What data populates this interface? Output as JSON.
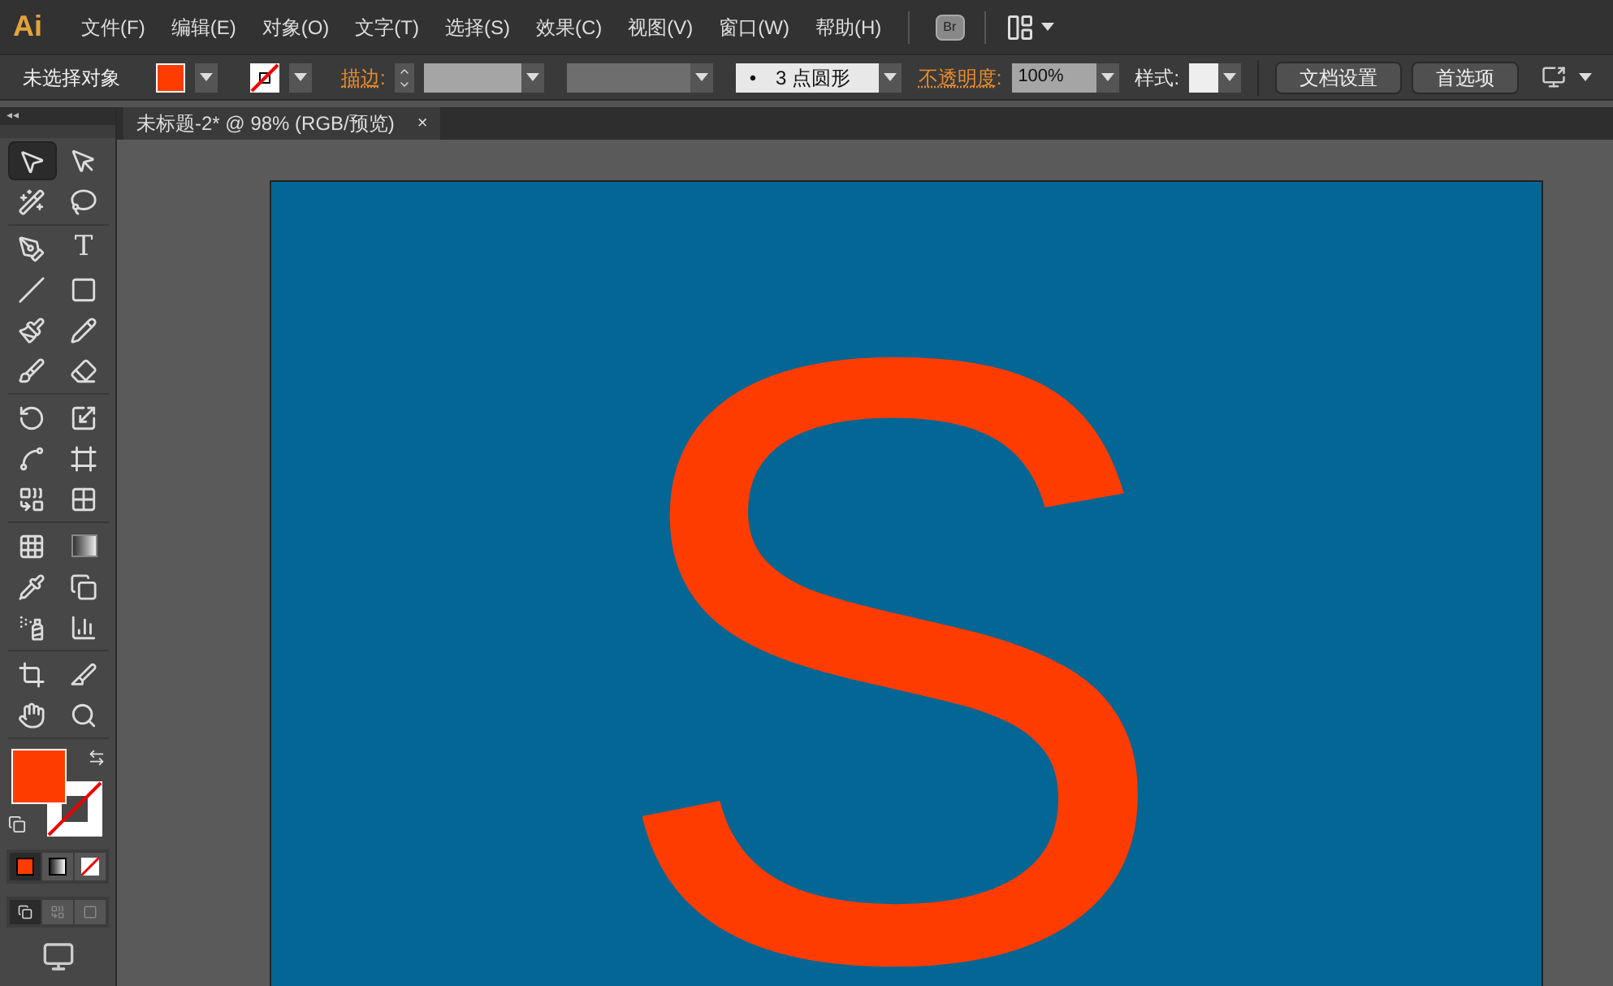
{
  "app": {
    "logo": "Ai"
  },
  "menu": [
    "文件(F)",
    "编辑(E)",
    "对象(O)",
    "文字(T)",
    "选择(S)",
    "效果(C)",
    "视图(V)",
    "窗口(W)",
    "帮助(H)"
  ],
  "bridge_button": {
    "label": "Br"
  },
  "control_bar": {
    "selection": "未选择对象",
    "fill": {
      "color": "#ff3c00"
    },
    "stroke": {
      "none": true
    },
    "stroke_label": "描边",
    "stroke_separator": ":",
    "brush": {
      "dot": "•",
      "value": "3 点圆形"
    },
    "opacity_label": "不透明度",
    "opacity_separator": ":",
    "opacity": "100%",
    "style_label": "样式:",
    "buttons": [
      "文档设置",
      "首选项"
    ]
  },
  "toolbox": {
    "collapse": "◂◂",
    "groups": [
      {
        "tools": [
          {
            "kind": "selection",
            "selected": true
          },
          {
            "kind": "direct-selection",
            "selected": false
          },
          {
            "kind": "magic-wand",
            "selected": false
          },
          {
            "kind": "lasso",
            "selected": false
          }
        ]
      },
      {
        "tools": [
          {
            "kind": "pen",
            "selected": false
          },
          {
            "kind": "type",
            "glyph": "T",
            "selected": false
          },
          {
            "kind": "line",
            "selected": false
          },
          {
            "kind": "rectangle",
            "selected": false
          },
          {
            "kind": "paintbrush",
            "selected": false
          },
          {
            "kind": "pencil",
            "selected": false
          },
          {
            "kind": "blob-brush",
            "selected": false
          },
          {
            "kind": "eraser",
            "selected": false
          }
        ]
      },
      {
        "tools": [
          {
            "kind": "rotate",
            "selected": false
          },
          {
            "kind": "scale",
            "selected": false
          },
          {
            "kind": "warp",
            "selected": false
          },
          {
            "kind": "free-transform",
            "selected": false
          },
          {
            "kind": "shape-builder",
            "selected": false
          },
          {
            "kind": "graph-grid",
            "selected": false
          }
        ]
      },
      {
        "tools": [
          {
            "kind": "mesh",
            "selected": false
          },
          {
            "kind": "gradient",
            "selected": false
          },
          {
            "kind": "eyedropper",
            "selected": false
          },
          {
            "kind": "blend",
            "selected": false
          },
          {
            "kind": "sprayer",
            "selected": false
          },
          {
            "kind": "column-graph",
            "selected": false
          }
        ]
      },
      {
        "tools": [
          {
            "kind": "artboard",
            "selected": false
          },
          {
            "kind": "slice",
            "selected": false
          },
          {
            "kind": "hand",
            "selected": false
          },
          {
            "kind": "zoom",
            "selected": false
          }
        ]
      }
    ],
    "fill": {
      "color": "#ff3c00"
    },
    "stroke": {
      "none": true
    },
    "modes": [
      {
        "kind": "color",
        "selected": true
      },
      {
        "kind": "gradient",
        "selected": false
      },
      {
        "kind": "none",
        "selected": false
      }
    ],
    "draw_modes": [
      {
        "kind": "normal",
        "selected": true
      },
      {
        "kind": "behind",
        "selected": false
      },
      {
        "kind": "inside",
        "selected": false
      }
    ]
  },
  "document_tab": {
    "title": "未标题-2* @ 98% (RGB/预览)",
    "close": "×"
  },
  "artboard": {
    "color": "#036694",
    "letter": {
      "text": "S",
      "color": "#ff3c00"
    }
  }
}
